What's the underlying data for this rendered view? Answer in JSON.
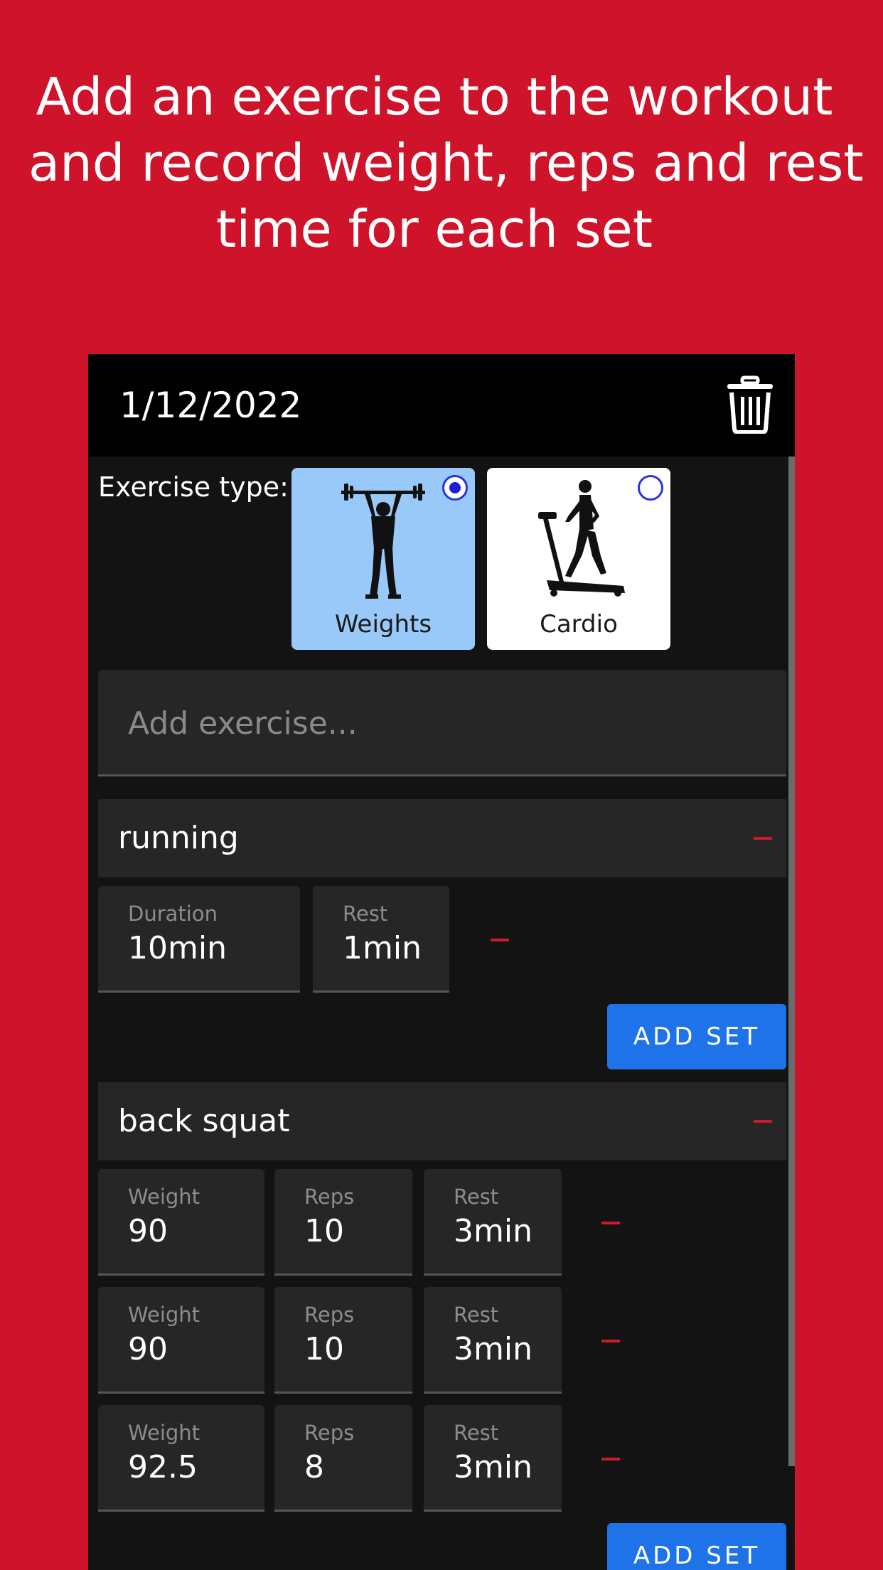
{
  "promo": {
    "line1": "Add an exercise to the workout",
    "line2": "and record weight, reps and rest",
    "line3": "time for each set"
  },
  "app": {
    "date": "1/12/2022",
    "exercise_type_label": "Exercise type:",
    "types": [
      {
        "label": "Weights",
        "selected": true
      },
      {
        "label": "Cardio",
        "selected": false
      }
    ],
    "add_exercise_placeholder": "Add exercise...",
    "add_set_label": "ADD SET"
  },
  "exercises": [
    {
      "name": "running",
      "sets": [
        {
          "duration_label": "Duration",
          "duration": "10min",
          "rest_label": "Rest",
          "rest": "1min"
        }
      ]
    },
    {
      "name": "back squat",
      "sets": [
        {
          "weight_label": "Weight",
          "weight": "90",
          "reps_label": "Reps",
          "reps": "10",
          "rest_label": "Rest",
          "rest": "3min"
        },
        {
          "weight_label": "Weight",
          "weight": "90",
          "reps_label": "Reps",
          "reps": "10",
          "rest_label": "Rest",
          "rest": "3min"
        },
        {
          "weight_label": "Weight",
          "weight": "92.5",
          "reps_label": "Reps",
          "reps": "8",
          "rest_label": "Rest",
          "rest": "3min"
        }
      ]
    }
  ],
  "colors": {
    "background": "#cf132b",
    "accent_button": "#1f73e8",
    "selected_tile": "#99c9f9",
    "remove_icon": "#cf1a2c"
  },
  "icons": [
    "trash-icon",
    "weightlifter-icon",
    "treadmill-runner-icon",
    "radio-selected-icon",
    "radio-unselected-icon",
    "minus-icon"
  ]
}
